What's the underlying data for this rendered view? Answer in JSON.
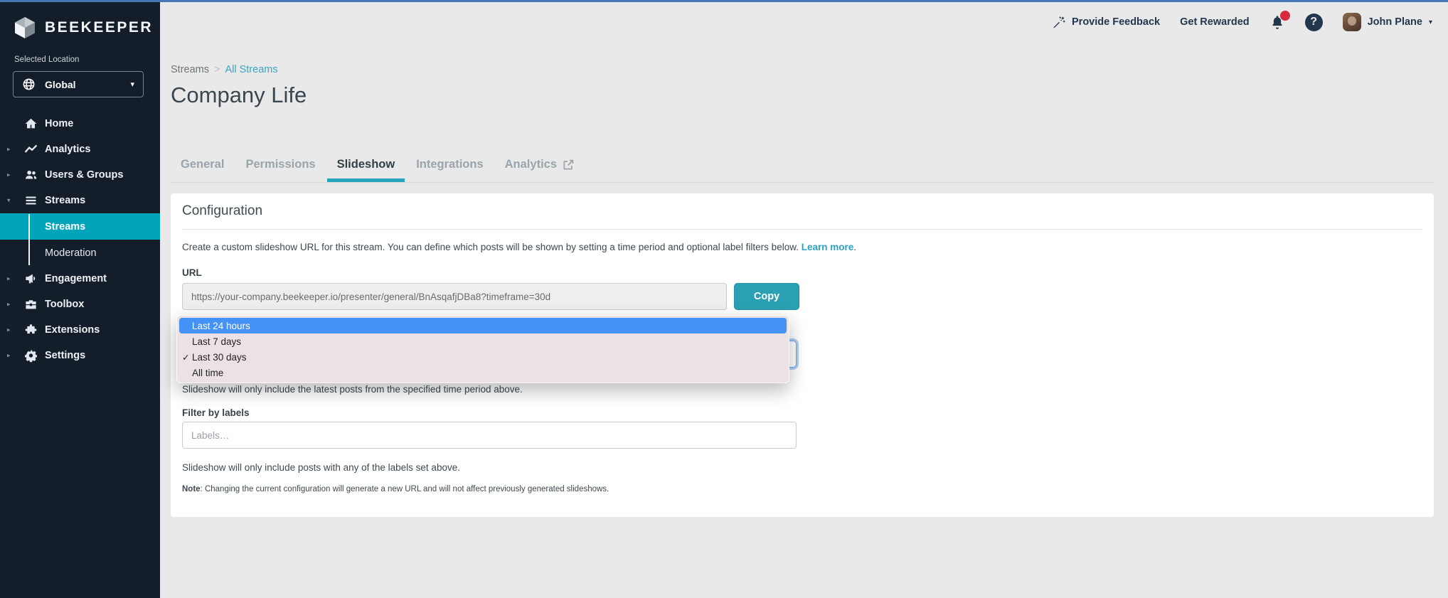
{
  "app": {
    "brand": "BEEKEEPER"
  },
  "colors": {
    "accent_teal": "#00a5bc",
    "button_teal": "#2aa0b2",
    "tab_underline": "#25a5bb",
    "link_teal": "#2aa2c0",
    "popup_highlight": "#4592f7",
    "notification_badge": "#d9293d",
    "sidebar_bg": "#141e2b",
    "top_strip": "#4677b3"
  },
  "icons": {
    "caret_right": "▸",
    "caret_down": "▾",
    "caret_small": "▾",
    "chevron_down": "⌄",
    "check": "✓",
    "help_glyph": "?"
  },
  "sidebar": {
    "selected_location_label": "Selected Location",
    "location_value": "Global",
    "nav": [
      {
        "label": "Home"
      },
      {
        "label": "Analytics"
      },
      {
        "label": "Users & Groups"
      },
      {
        "label": "Streams"
      },
      {
        "label": "Engagement"
      },
      {
        "label": "Toolbox"
      },
      {
        "label": "Extensions"
      },
      {
        "label": "Settings"
      }
    ],
    "streams_children": [
      {
        "label": "Streams",
        "active": true
      },
      {
        "label": "Moderation",
        "active": false
      }
    ]
  },
  "header": {
    "provide_feedback": "Provide Feedback",
    "get_rewarded": "Get Rewarded",
    "user_name": "John Plane"
  },
  "breadcrumb": {
    "parent": "Streams",
    "separator": ">",
    "current": "All Streams"
  },
  "page": {
    "title": "Company Life"
  },
  "tabs": [
    {
      "label": "General"
    },
    {
      "label": "Permissions"
    },
    {
      "label": "Slideshow",
      "active": true
    },
    {
      "label": "Integrations"
    },
    {
      "label": "Analytics",
      "external": true
    }
  ],
  "config": {
    "heading": "Configuration",
    "description": "Create a custom slideshow URL for this stream. You can define which posts will be shown by setting a time period and optional label filters below. ",
    "learn_more": "Learn more",
    "learn_more_suffix": ".",
    "url_label": "URL",
    "url_value": "https://your-company.beekeeper.io/presenter/general/BnAsqafjDBa8?timeframe=30d",
    "copy_label": "Copy",
    "time_period_help": "Slideshow will only include the latest posts from the specified time period above.",
    "filter_label": "Filter by labels",
    "labels_placeholder": "Labels…",
    "labels_help": "Slideshow will only include posts with any of the labels set above.",
    "note_label": "Note",
    "note_text": ": Changing the current configuration will generate a new URL and will not affect previously generated slideshows."
  },
  "dropdown": {
    "options": [
      {
        "label": "Last 24 hours"
      },
      {
        "label": "Last 7 days"
      },
      {
        "label": "Last 30 days"
      },
      {
        "label": "All time"
      }
    ]
  }
}
